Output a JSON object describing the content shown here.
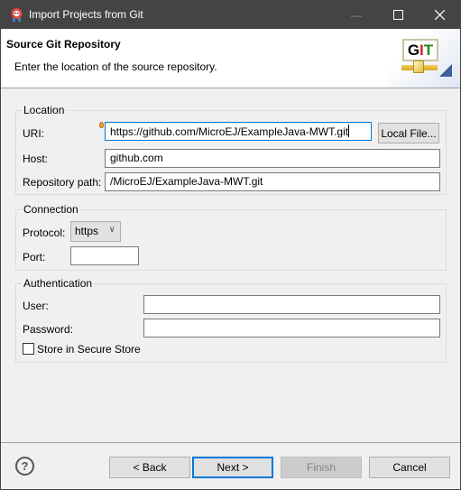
{
  "window": {
    "title": "Import Projects from Git",
    "app_icon": "eclipse-egit-icon",
    "controls": {
      "minimize": "—",
      "maximize": "☐",
      "close": "✕"
    }
  },
  "header": {
    "title": "Source Git Repository",
    "description": "Enter the location of the source repository.",
    "logo_text": [
      "G",
      "I",
      "T"
    ],
    "logo_colors": [
      "#000000",
      "#d02020",
      "#1a8a1a"
    ]
  },
  "location": {
    "legend": "Location",
    "uri_label": "URI:",
    "uri_value": "https://github.com/MicroEJ/ExampleJava-MWT.git",
    "local_file_button": "Local File...",
    "host_label": "Host:",
    "host_value": "github.com",
    "repo_path_label": "Repository path:",
    "repo_path_value": "/MicroEJ/ExampleJava-MWT.git"
  },
  "connection": {
    "legend": "Connection",
    "protocol_label": "Protocol:",
    "protocol_value": "https",
    "port_label": "Port:",
    "port_value": ""
  },
  "authentication": {
    "legend": "Authentication",
    "user_label": "User:",
    "user_value": "",
    "password_label": "Password:",
    "password_value": "",
    "store_label": "Store in Secure Store",
    "store_checked": false
  },
  "footer": {
    "help": "?",
    "back": "< Back",
    "next": "Next >",
    "finish": "Finish",
    "cancel": "Cancel"
  },
  "colors": {
    "titlebar": "#444444",
    "focus": "#0078d7"
  }
}
